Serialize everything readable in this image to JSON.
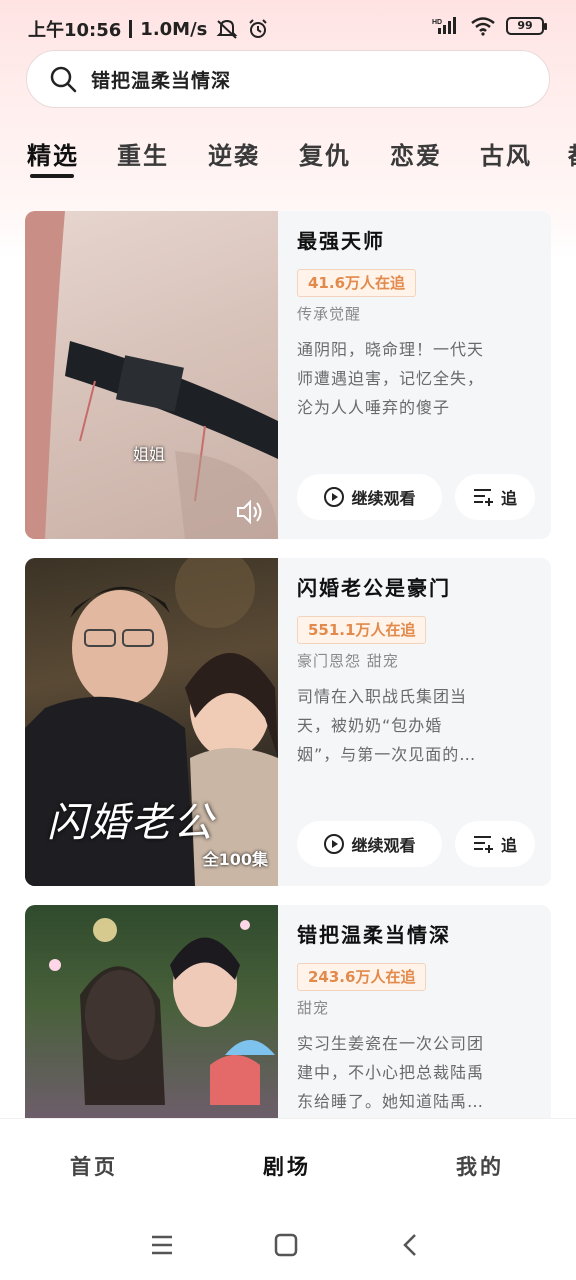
{
  "status_bar": {
    "time": "上午10:56",
    "speed": "1.0M/s",
    "battery": "99",
    "signal_label": "HD"
  },
  "search": {
    "value": "错把温柔当情深"
  },
  "tabs": [
    {
      "label": "精选",
      "active": true
    },
    {
      "label": "重生",
      "active": false
    },
    {
      "label": "逆袭",
      "active": false
    },
    {
      "label": "复仇",
      "active": false
    },
    {
      "label": "恋爱",
      "active": false
    },
    {
      "label": "古风",
      "active": false
    },
    {
      "label": "都",
      "active": false
    }
  ],
  "cards": [
    {
      "title": "最强天师",
      "viewers": "41.6万人在追",
      "tags": "传承觉醒",
      "desc": [
        "通阴阳，晓命理！一代天",
        "师遭遇迫害，记忆全失，",
        "沦为人人唾弃的傻子"
      ],
      "poster_subtitle": "姐姐",
      "continue_label": "继续观看",
      "follow_label": "追"
    },
    {
      "title": "闪婚老公是豪门",
      "viewers": "551.1万人在追",
      "tags": "豪门恩怨  甜宠",
      "desc": [
        "司情在入职战氏集团当",
        "天，被奶奶“包办婚",
        "姻”，与第一次见面的…"
      ],
      "poster_art": "闪婚老公",
      "episodes": "全100集",
      "continue_label": "继续观看",
      "follow_label": "追"
    },
    {
      "title": "错把温柔当情深",
      "viewers": "243.6万人在追",
      "tags": "甜宠",
      "desc": [
        "实习生姜瓷在一次公司团",
        "建中，不小心把总裁陆禹",
        "东给睡了。她知道陆禹…"
      ]
    }
  ],
  "bottom_nav": [
    {
      "label": "首页"
    },
    {
      "label": "剧场"
    },
    {
      "label": "我的"
    }
  ],
  "colors": {
    "accent_orange": "#e28a4c",
    "header_pink": "#ffe3e3"
  }
}
